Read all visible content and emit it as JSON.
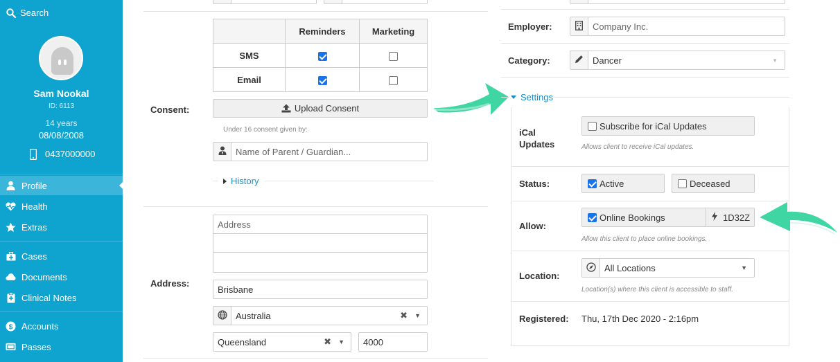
{
  "sidebar": {
    "search_label": "Search",
    "patient": {
      "name": "Sam Nookal",
      "id": "ID: 6113",
      "age": "14 years",
      "dob": "08/08/2008",
      "phone": "0437000000"
    },
    "nav": [
      {
        "label": "Profile",
        "icon": "user-icon",
        "active": true
      },
      {
        "label": "Health",
        "icon": "heartbeat-icon"
      },
      {
        "label": "Extras",
        "icon": "star-icon"
      },
      {
        "label": "Cases",
        "icon": "briefcase-medical-icon"
      },
      {
        "label": "Documents",
        "icon": "cloud-icon"
      },
      {
        "label": "Clinical Notes",
        "icon": "clipboard-medical-icon"
      },
      {
        "label": "Accounts",
        "icon": "dollar-icon"
      },
      {
        "label": "Passes",
        "icon": "ticket-icon"
      }
    ]
  },
  "consent": {
    "label": "Consent:",
    "columns": [
      "",
      "Reminders",
      "Marketing"
    ],
    "rows": [
      {
        "label": "SMS",
        "reminders": true,
        "marketing": false
      },
      {
        "label": "Email",
        "reminders": true,
        "marketing": false
      }
    ],
    "upload_button": "Upload Consent",
    "under16_text": "Under 16 consent given by:",
    "guardian_placeholder": "Name of Parent / Guardian...",
    "history_link": "History"
  },
  "address": {
    "label": "Address:",
    "line1_placeholder": "Address",
    "city": "Brisbane",
    "country": "Australia",
    "state": "Queensland",
    "postcode": "4000"
  },
  "right": {
    "employer_label": "Employer:",
    "employer_value": "Company Inc.",
    "category_label": "Category:",
    "category_value": "Dancer",
    "settings_link": "Settings",
    "ical_label": "iCal Updates",
    "ical_checkbox": "Subscribe for iCal Updates",
    "ical_checked": false,
    "ical_help": "Allows client to receive iCal updates.",
    "status_label": "Status:",
    "status_active": "Active",
    "status_active_checked": true,
    "status_deceased": "Deceased",
    "status_deceased_checked": false,
    "allow_label": "Allow:",
    "allow_online": "Online Bookings",
    "allow_online_checked": true,
    "allow_code": "1D32Z",
    "allow_help": "Allow this client to place online bookings.",
    "location_label": "Location:",
    "location_value": "All Locations",
    "location_help": "Location(s) where this client is accessible to staff.",
    "registered_label": "Registered:",
    "registered_value": "Thu, 17th Dec 2020 - 2:16pm"
  },
  "colors": {
    "sidebar": "#0fa3cf",
    "link": "#1c8cc3",
    "arrow": "#3fd6a3",
    "checkbox": "#1a73e8"
  }
}
